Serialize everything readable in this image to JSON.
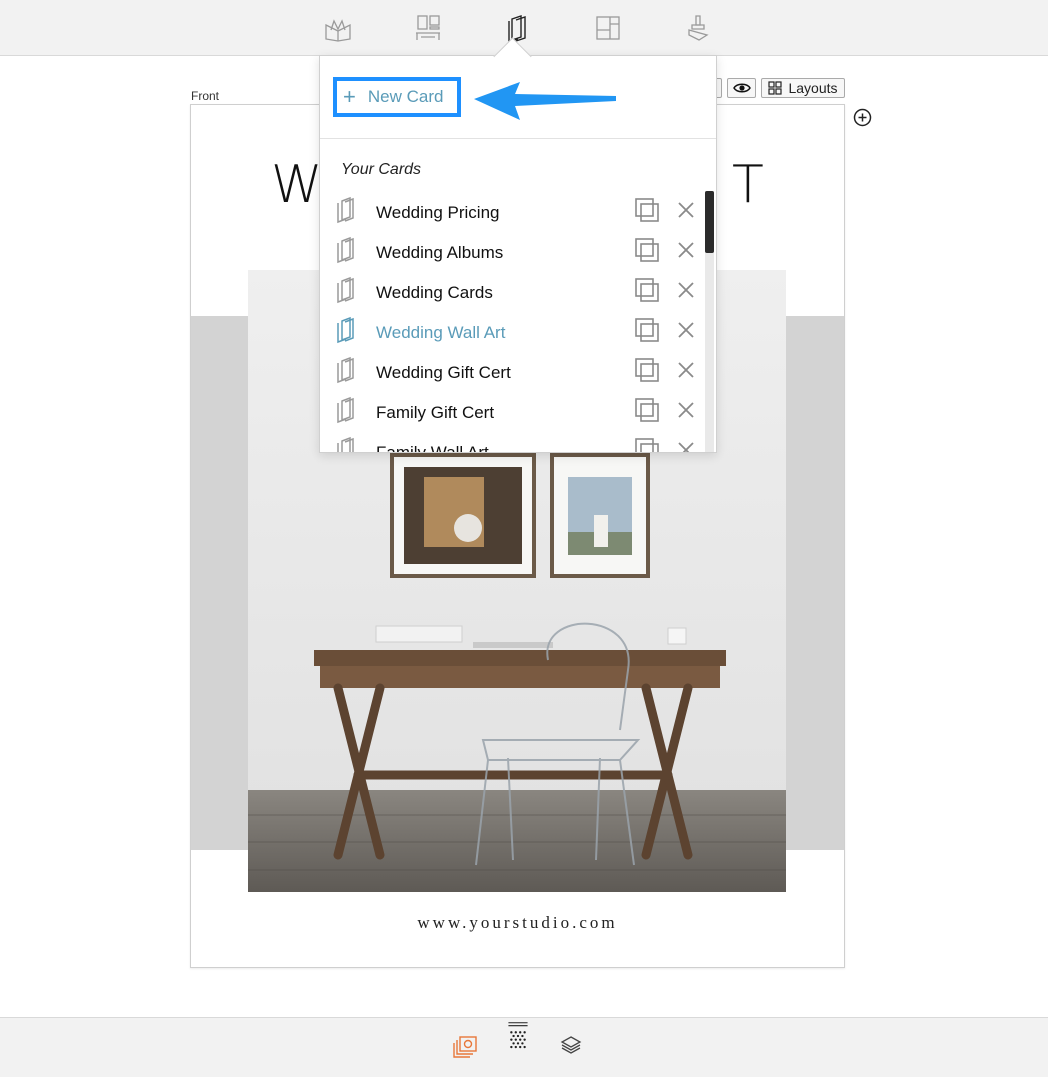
{
  "toolbar": {
    "icons": [
      "book-icon",
      "templates-icon",
      "cards-icon",
      "layout-icon",
      "stamp-icon"
    ],
    "active": "cards-icon"
  },
  "canvas": {
    "side_label": "Front",
    "title_left": "W",
    "title_right": "T",
    "url": "www.yourstudio.com",
    "layouts_label": "Layouts"
  },
  "popover": {
    "new_card_label": "New Card",
    "section_title": "Your Cards",
    "cards": [
      {
        "name": "Wedding Pricing",
        "active": false
      },
      {
        "name": "Wedding Albums",
        "active": false
      },
      {
        "name": "Wedding Cards",
        "active": false
      },
      {
        "name": "Wedding Wall Art",
        "active": true
      },
      {
        "name": "Wedding Gift Cert",
        "active": false
      },
      {
        "name": "Family Gift Cert",
        "active": false
      },
      {
        "name": "Family Wall Art",
        "active": false
      }
    ]
  },
  "colors": {
    "accent": "#5a9bb8",
    "highlight": "#1e90ff",
    "arrow": "#2196f3",
    "bottom_active": "#e8773a"
  },
  "bottombar": {
    "icons": [
      "layers-photo-icon",
      "pattern-icon",
      "stack-icon"
    ]
  }
}
